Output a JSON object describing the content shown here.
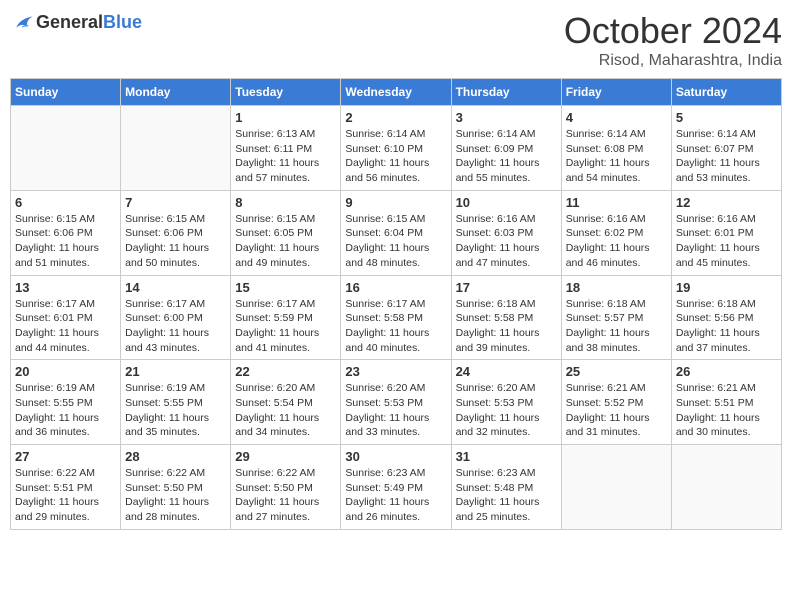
{
  "logo": {
    "text_general": "General",
    "text_blue": "Blue"
  },
  "title": "October 2024",
  "location": "Risod, Maharashtra, India",
  "days_of_week": [
    "Sunday",
    "Monday",
    "Tuesday",
    "Wednesday",
    "Thursday",
    "Friday",
    "Saturday"
  ],
  "weeks": [
    [
      {
        "day": "",
        "sunrise": "",
        "sunset": "",
        "daylight": ""
      },
      {
        "day": "",
        "sunrise": "",
        "sunset": "",
        "daylight": ""
      },
      {
        "day": "1",
        "sunrise": "Sunrise: 6:13 AM",
        "sunset": "Sunset: 6:11 PM",
        "daylight": "Daylight: 11 hours and 57 minutes."
      },
      {
        "day": "2",
        "sunrise": "Sunrise: 6:14 AM",
        "sunset": "Sunset: 6:10 PM",
        "daylight": "Daylight: 11 hours and 56 minutes."
      },
      {
        "day": "3",
        "sunrise": "Sunrise: 6:14 AM",
        "sunset": "Sunset: 6:09 PM",
        "daylight": "Daylight: 11 hours and 55 minutes."
      },
      {
        "day": "4",
        "sunrise": "Sunrise: 6:14 AM",
        "sunset": "Sunset: 6:08 PM",
        "daylight": "Daylight: 11 hours and 54 minutes."
      },
      {
        "day": "5",
        "sunrise": "Sunrise: 6:14 AM",
        "sunset": "Sunset: 6:07 PM",
        "daylight": "Daylight: 11 hours and 53 minutes."
      }
    ],
    [
      {
        "day": "6",
        "sunrise": "Sunrise: 6:15 AM",
        "sunset": "Sunset: 6:06 PM",
        "daylight": "Daylight: 11 hours and 51 minutes."
      },
      {
        "day": "7",
        "sunrise": "Sunrise: 6:15 AM",
        "sunset": "Sunset: 6:06 PM",
        "daylight": "Daylight: 11 hours and 50 minutes."
      },
      {
        "day": "8",
        "sunrise": "Sunrise: 6:15 AM",
        "sunset": "Sunset: 6:05 PM",
        "daylight": "Daylight: 11 hours and 49 minutes."
      },
      {
        "day": "9",
        "sunrise": "Sunrise: 6:15 AM",
        "sunset": "Sunset: 6:04 PM",
        "daylight": "Daylight: 11 hours and 48 minutes."
      },
      {
        "day": "10",
        "sunrise": "Sunrise: 6:16 AM",
        "sunset": "Sunset: 6:03 PM",
        "daylight": "Daylight: 11 hours and 47 minutes."
      },
      {
        "day": "11",
        "sunrise": "Sunrise: 6:16 AM",
        "sunset": "Sunset: 6:02 PM",
        "daylight": "Daylight: 11 hours and 46 minutes."
      },
      {
        "day": "12",
        "sunrise": "Sunrise: 6:16 AM",
        "sunset": "Sunset: 6:01 PM",
        "daylight": "Daylight: 11 hours and 45 minutes."
      }
    ],
    [
      {
        "day": "13",
        "sunrise": "Sunrise: 6:17 AM",
        "sunset": "Sunset: 6:01 PM",
        "daylight": "Daylight: 11 hours and 44 minutes."
      },
      {
        "day": "14",
        "sunrise": "Sunrise: 6:17 AM",
        "sunset": "Sunset: 6:00 PM",
        "daylight": "Daylight: 11 hours and 43 minutes."
      },
      {
        "day": "15",
        "sunrise": "Sunrise: 6:17 AM",
        "sunset": "Sunset: 5:59 PM",
        "daylight": "Daylight: 11 hours and 41 minutes."
      },
      {
        "day": "16",
        "sunrise": "Sunrise: 6:17 AM",
        "sunset": "Sunset: 5:58 PM",
        "daylight": "Daylight: 11 hours and 40 minutes."
      },
      {
        "day": "17",
        "sunrise": "Sunrise: 6:18 AM",
        "sunset": "Sunset: 5:58 PM",
        "daylight": "Daylight: 11 hours and 39 minutes."
      },
      {
        "day": "18",
        "sunrise": "Sunrise: 6:18 AM",
        "sunset": "Sunset: 5:57 PM",
        "daylight": "Daylight: 11 hours and 38 minutes."
      },
      {
        "day": "19",
        "sunrise": "Sunrise: 6:18 AM",
        "sunset": "Sunset: 5:56 PM",
        "daylight": "Daylight: 11 hours and 37 minutes."
      }
    ],
    [
      {
        "day": "20",
        "sunrise": "Sunrise: 6:19 AM",
        "sunset": "Sunset: 5:55 PM",
        "daylight": "Daylight: 11 hours and 36 minutes."
      },
      {
        "day": "21",
        "sunrise": "Sunrise: 6:19 AM",
        "sunset": "Sunset: 5:55 PM",
        "daylight": "Daylight: 11 hours and 35 minutes."
      },
      {
        "day": "22",
        "sunrise": "Sunrise: 6:20 AM",
        "sunset": "Sunset: 5:54 PM",
        "daylight": "Daylight: 11 hours and 34 minutes."
      },
      {
        "day": "23",
        "sunrise": "Sunrise: 6:20 AM",
        "sunset": "Sunset: 5:53 PM",
        "daylight": "Daylight: 11 hours and 33 minutes."
      },
      {
        "day": "24",
        "sunrise": "Sunrise: 6:20 AM",
        "sunset": "Sunset: 5:53 PM",
        "daylight": "Daylight: 11 hours and 32 minutes."
      },
      {
        "day": "25",
        "sunrise": "Sunrise: 6:21 AM",
        "sunset": "Sunset: 5:52 PM",
        "daylight": "Daylight: 11 hours and 31 minutes."
      },
      {
        "day": "26",
        "sunrise": "Sunrise: 6:21 AM",
        "sunset": "Sunset: 5:51 PM",
        "daylight": "Daylight: 11 hours and 30 minutes."
      }
    ],
    [
      {
        "day": "27",
        "sunrise": "Sunrise: 6:22 AM",
        "sunset": "Sunset: 5:51 PM",
        "daylight": "Daylight: 11 hours and 29 minutes."
      },
      {
        "day": "28",
        "sunrise": "Sunrise: 6:22 AM",
        "sunset": "Sunset: 5:50 PM",
        "daylight": "Daylight: 11 hours and 28 minutes."
      },
      {
        "day": "29",
        "sunrise": "Sunrise: 6:22 AM",
        "sunset": "Sunset: 5:50 PM",
        "daylight": "Daylight: 11 hours and 27 minutes."
      },
      {
        "day": "30",
        "sunrise": "Sunrise: 6:23 AM",
        "sunset": "Sunset: 5:49 PM",
        "daylight": "Daylight: 11 hours and 26 minutes."
      },
      {
        "day": "31",
        "sunrise": "Sunrise: 6:23 AM",
        "sunset": "Sunset: 5:48 PM",
        "daylight": "Daylight: 11 hours and 25 minutes."
      },
      {
        "day": "",
        "sunrise": "",
        "sunset": "",
        "daylight": ""
      },
      {
        "day": "",
        "sunrise": "",
        "sunset": "",
        "daylight": ""
      }
    ]
  ]
}
